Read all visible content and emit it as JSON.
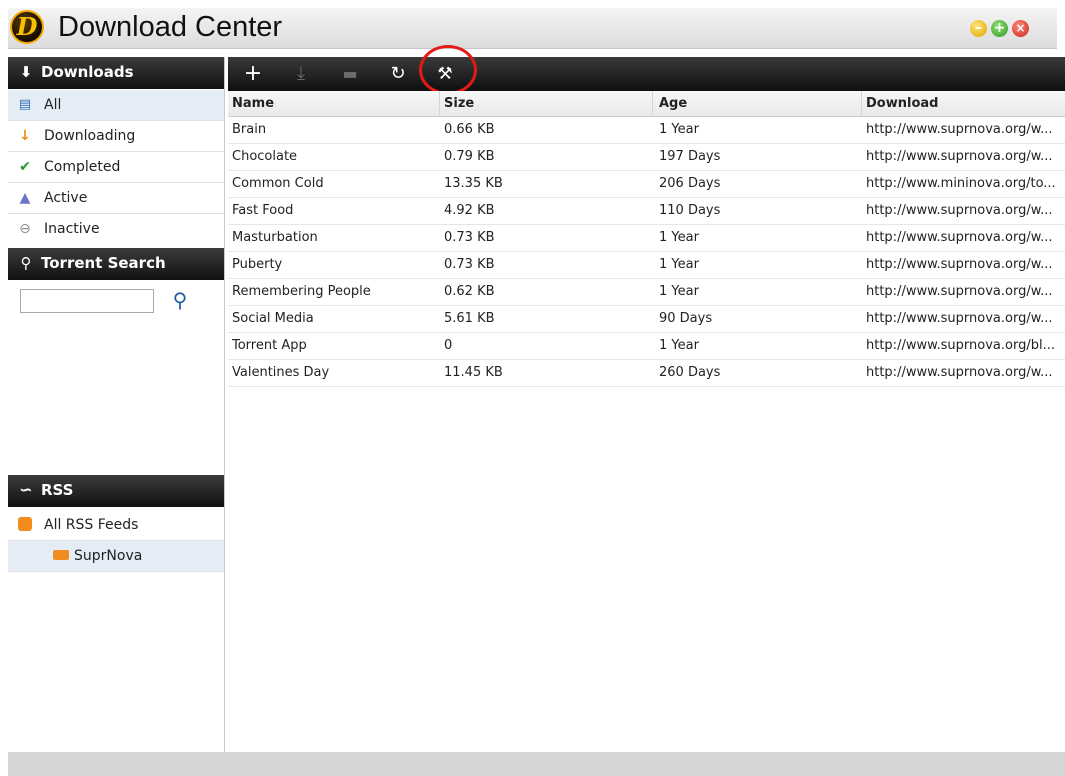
{
  "window": {
    "logo_letter": "D",
    "title": "Download Center",
    "controls": [
      "minimize",
      "maximize",
      "close"
    ]
  },
  "sidebar": {
    "downloads_header": "Downloads",
    "downloads_items": [
      {
        "label": "All",
        "icon": "list-icon",
        "selected": true
      },
      {
        "label": "Downloading",
        "icon": "arrow-down-icon"
      },
      {
        "label": "Completed",
        "icon": "check-icon"
      },
      {
        "label": "Active",
        "icon": "active-triangle-icon"
      },
      {
        "label": "Inactive",
        "icon": "minus-circle-icon"
      }
    ],
    "search_header": "Torrent Search",
    "search_value": "",
    "rss_header": "RSS",
    "rss_items": [
      {
        "label": "All RSS Feeds",
        "icon": "rss-icon"
      },
      {
        "label": "SuprNova",
        "icon": "rss-feed-icon",
        "selected": true
      }
    ]
  },
  "toolbar": {
    "buttons": [
      {
        "name": "add",
        "icon": "plus-icon",
        "enabled": true
      },
      {
        "name": "download",
        "icon": "download-icon",
        "enabled": false
      },
      {
        "name": "folder",
        "icon": "folder-icon",
        "enabled": false
      },
      {
        "name": "refresh",
        "icon": "refresh-icon",
        "enabled": true
      },
      {
        "name": "rss-settings",
        "icon": "wrench-rss-icon",
        "enabled": true,
        "highlighted": true
      }
    ]
  },
  "table": {
    "columns": [
      "Name",
      "Size",
      "Age",
      "Download"
    ],
    "rows": [
      [
        "Brain",
        "0.66 KB",
        "1 Year",
        "http://www.suprnova.org/w..."
      ],
      [
        "Chocolate",
        "0.79 KB",
        "197 Days",
        "http://www.suprnova.org/w..."
      ],
      [
        "Common Cold",
        "13.35 KB",
        "206 Days",
        "http://www.mininova.org/to..."
      ],
      [
        "Fast Food",
        "4.92 KB",
        "110 Days",
        "http://www.suprnova.org/w..."
      ],
      [
        "Masturbation",
        "0.73 KB",
        "1 Year",
        "http://www.suprnova.org/w..."
      ],
      [
        "Puberty",
        "0.73 KB",
        "1 Year",
        "http://www.suprnova.org/w..."
      ],
      [
        "Remembering People",
        "0.62 KB",
        "1 Year",
        "http://www.suprnova.org/w..."
      ],
      [
        "Social Media",
        "5.61 KB",
        "90 Days",
        "http://www.suprnova.org/w..."
      ],
      [
        "Torrent App",
        "0",
        "1 Year",
        "http://www.suprnova.org/bl..."
      ],
      [
        "Valentines Day",
        "11.45 KB",
        "260 Days",
        "http://www.suprnova.org/w..."
      ]
    ]
  },
  "colors": {
    "header_dark": "#111111",
    "selection": "#e4edf6",
    "highlight_ring": "#e41a14",
    "search_icon": "#1f5fa6"
  }
}
